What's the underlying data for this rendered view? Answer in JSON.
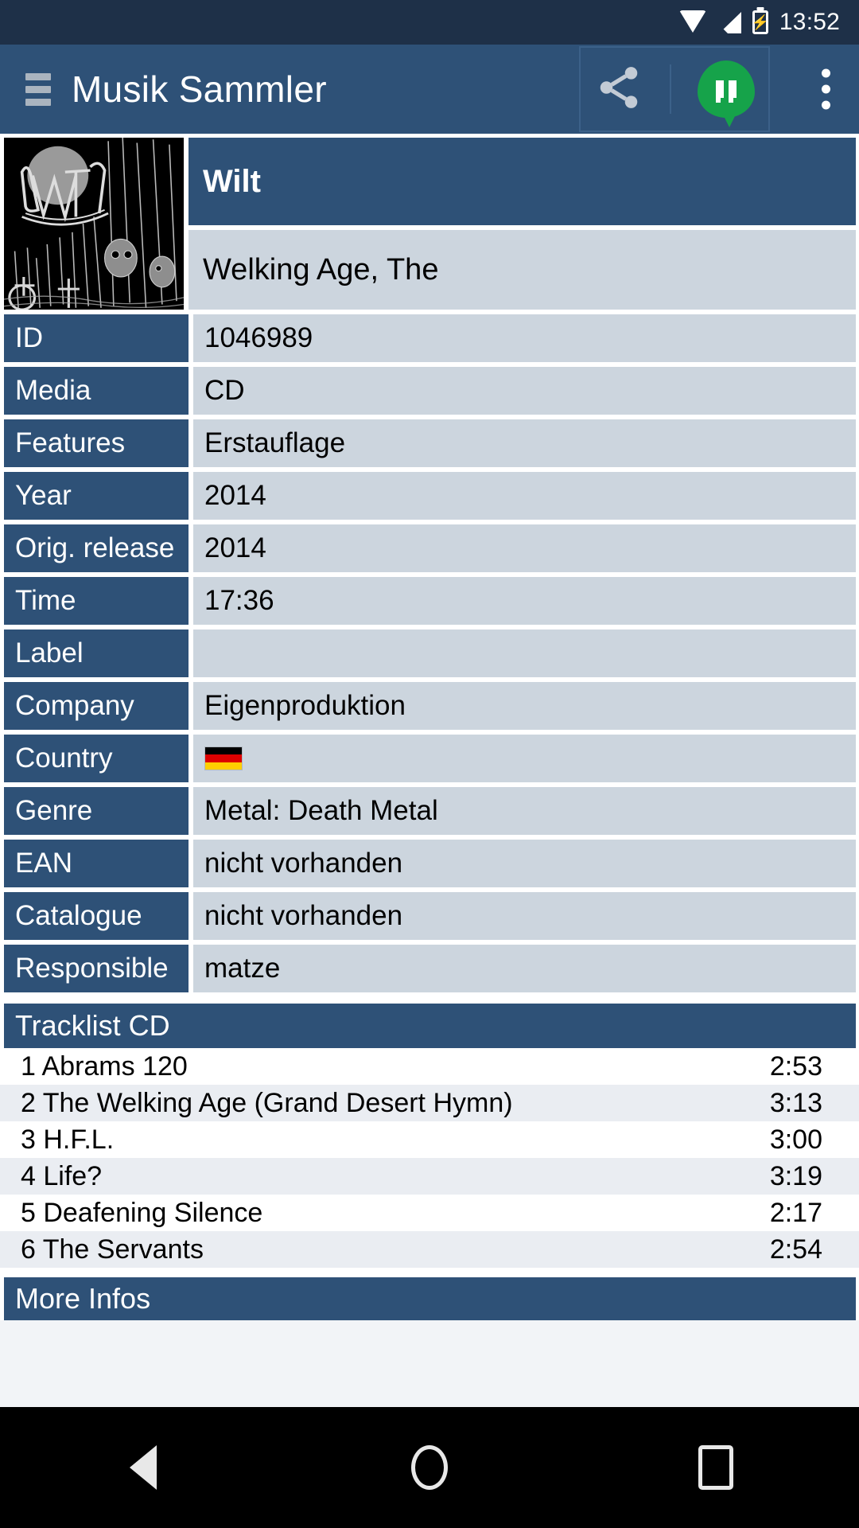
{
  "statusbar": {
    "time": "13:52",
    "icons": [
      "wifi-icon",
      "signal-icon",
      "battery-charging-icon"
    ]
  },
  "appbar": {
    "menu_icon": "hamburger-menu-icon",
    "title": "Musik Sammler",
    "share_icon": "share-icon",
    "hangouts_icon": "hangouts-icon",
    "overflow_icon": "overflow-menu-icon"
  },
  "album": {
    "cover_alt": "wilt-album-cover",
    "artist": "Wilt",
    "title": "Welking Age, The"
  },
  "info_rows": [
    {
      "label": "ID",
      "value": "1046989"
    },
    {
      "label": "Media",
      "value": "CD"
    },
    {
      "label": "Features",
      "value": "Erstauflage"
    },
    {
      "label": "Year",
      "value": "2014"
    },
    {
      "label": "Orig. release",
      "value": "2014"
    },
    {
      "label": "Time",
      "value": "17:36"
    },
    {
      "label": "Label",
      "value": ""
    },
    {
      "label": "Company",
      "value": "Eigenproduktion"
    },
    {
      "label": "Country",
      "value": "",
      "flag": "germany-flag"
    },
    {
      "label": "Genre",
      "value": "Metal: Death Metal"
    },
    {
      "label": "EAN",
      "value": "nicht vorhanden"
    },
    {
      "label": "Catalogue",
      "value": "nicht vorhanden"
    },
    {
      "label": "Responsible",
      "value": "matze"
    }
  ],
  "tracklist": {
    "header": "Tracklist CD",
    "tracks": [
      {
        "title": "1 Abrams 120",
        "time": "2:53"
      },
      {
        "title": "2 The Welking Age (Grand Desert Hymn)",
        "time": "3:13"
      },
      {
        "title": "3 H.F.L.",
        "time": "3:00"
      },
      {
        "title": "4 Life?",
        "time": "3:19"
      },
      {
        "title": "5 Deafening Silence",
        "time": "2:17"
      },
      {
        "title": "6 The Servants",
        "time": "2:54"
      }
    ]
  },
  "more_infos": {
    "header": "More Infos"
  },
  "navbar": {
    "back": "back-nav-icon",
    "home": "home-nav-icon",
    "recents": "recents-nav-icon"
  },
  "colors": {
    "status_bar": "#1e3048",
    "app_bar": "#2e5177",
    "label_bg": "#2e5177",
    "value_bg": "#ccd5de",
    "accent_green": "#16A34A",
    "row_alt": "#eaedf2"
  },
  "flag_colors": {
    "germany": [
      "#000000",
      "#DD0000",
      "#FFCE00"
    ]
  }
}
